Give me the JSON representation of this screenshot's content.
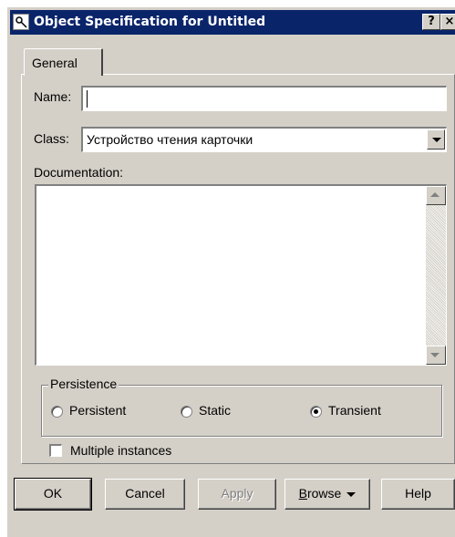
{
  "window": {
    "title": "Object Specification for Untitled",
    "help_button": "?",
    "close_button": "×"
  },
  "tabs": [
    {
      "label": "General",
      "selected": true
    }
  ],
  "general": {
    "name_label": "Name:",
    "name_value": "",
    "class_label": "Class:",
    "class_value": "Устройство чтения карточки",
    "documentation_label": "Documentation:",
    "documentation_value": "",
    "persistence": {
      "title": "Persistence",
      "options": [
        {
          "label": "Persistent",
          "selected": false
        },
        {
          "label": "Static",
          "selected": false
        },
        {
          "label": "Transient",
          "selected": true
        }
      ]
    },
    "multiple_instances": {
      "label": "Multiple instances",
      "checked": false
    }
  },
  "buttons": {
    "ok": "OK",
    "cancel": "Cancel",
    "apply": "Apply",
    "browse_prefix": "B",
    "browse_rest": "rowse",
    "help": "Help"
  },
  "icons": {
    "app": "object-spec-icon",
    "dropdown": "chevron-down-icon",
    "scroll_up": "scroll-up-arrow-icon",
    "scroll_down": "scroll-down-arrow-icon"
  }
}
